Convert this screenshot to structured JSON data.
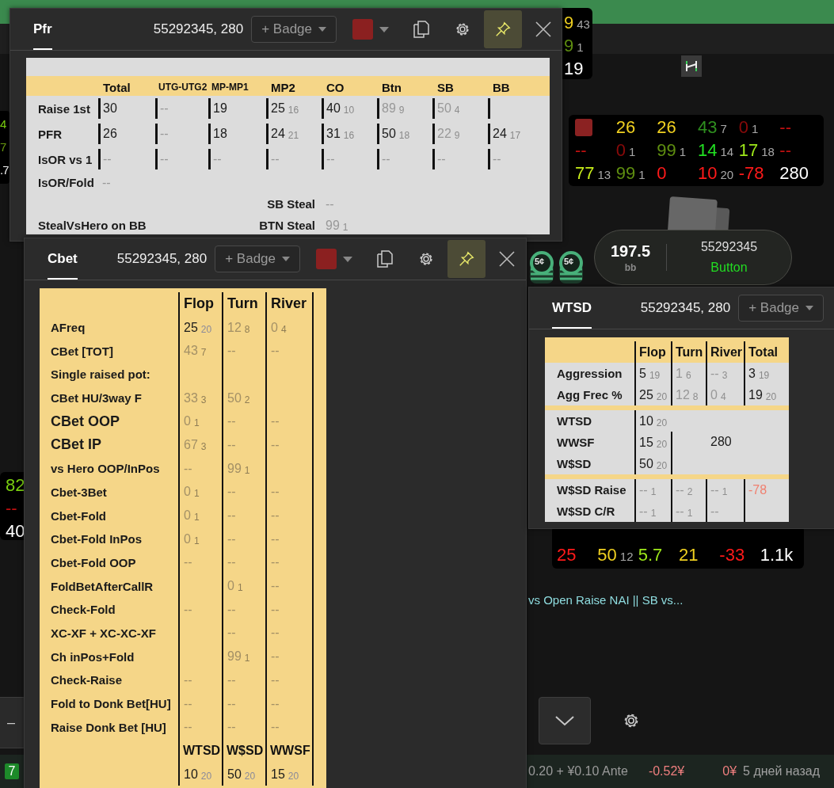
{
  "huds": [
    {
      "rows": [
        [
          {
            "kind": "stat",
            "value": "9",
            "count": "43",
            "color": "#f0d020"
          }
        ],
        [
          {
            "kind": "stat",
            "value": "9",
            "count": "1",
            "color": "#5f8f10"
          }
        ],
        [
          {
            "kind": "stat",
            "value": "19",
            "color": "#ffffff"
          }
        ]
      ]
    },
    {
      "rows": [
        [
          {
            "kind": "stat",
            "value": "4",
            "color": "#7ad010"
          }
        ],
        [
          {
            "kind": "stat",
            "value": "7",
            "color": "#6a9a10"
          }
        ],
        [
          {
            "kind": "stat",
            "value": ".7",
            "color": "#ffffff"
          }
        ]
      ]
    },
    {
      "rows": [
        [
          {
            "kind": "swatch",
            "color": "#8b2222"
          },
          {
            "kind": "stat",
            "value": "26",
            "color": "#f0d020"
          },
          {
            "kind": "stat",
            "value": "26",
            "color": "#f0d020"
          },
          {
            "kind": "stat",
            "value": "43",
            "count": "7",
            "color": "#2f8f1f"
          },
          {
            "kind": "stat",
            "value": "0",
            "count": "1",
            "color": "#8a0a0a"
          },
          {
            "kind": "stat",
            "value": "--",
            "color": "#c01010"
          }
        ],
        [
          {
            "kind": "stat",
            "value": "--",
            "color": "#c01010"
          },
          {
            "kind": "stat",
            "value": "0",
            "count": "1",
            "color": "#8a0a0a"
          },
          {
            "kind": "stat",
            "value": "99",
            "count": "1",
            "color": "#5f8f10"
          },
          {
            "kind": "stat",
            "value": "14",
            "count": "14",
            "color": "#22e022"
          },
          {
            "kind": "stat",
            "value": "17",
            "count": "18",
            "color": "#9ee81a"
          },
          {
            "kind": "stat",
            "value": "--",
            "color": "#c01010"
          }
        ],
        [
          {
            "kind": "stat",
            "value": "77",
            "count": "13",
            "color": "#c8ee1a"
          },
          {
            "kind": "stat",
            "value": "99",
            "count": "1",
            "color": "#5f8f10"
          },
          {
            "kind": "stat",
            "value": "0",
            "color": "#ff1a1a"
          },
          {
            "kind": "stat",
            "value": "10",
            "count": "20",
            "color": "#ff1a1a"
          },
          {
            "kind": "stat",
            "value": "-78",
            "color": "#ff1a1a"
          },
          {
            "kind": "stat",
            "value": "280",
            "color": "#ffffff"
          }
        ]
      ]
    },
    {
      "rows": [
        [
          {
            "kind": "stat",
            "value": "82",
            "color": "#7ad010"
          }
        ],
        [
          {
            "kind": "stat",
            "value": "--",
            "color": "#c01010"
          }
        ],
        [
          {
            "kind": "stat",
            "value": "40",
            "color": "#ffffff"
          }
        ]
      ]
    },
    {
      "rows": [
        [
          {
            "kind": "stat",
            "value": "25",
            "color": "#ff1a1a"
          },
          {
            "kind": "stat",
            "value": "50",
            "count": "12",
            "color": "#f0d020"
          },
          {
            "kind": "stat",
            "value": "5.7",
            "color": "#9ee81a"
          },
          {
            "kind": "stat",
            "value": "21",
            "color": "#f0d020"
          },
          {
            "kind": "stat",
            "value": "-33",
            "color": "#ff1a1a"
          },
          {
            "kind": "stat",
            "value": "1.1k",
            "color": "#ffffff"
          }
        ]
      ]
    }
  ],
  "player": {
    "stack": "197.5",
    "unit": "bb",
    "name": "55292345",
    "position": "Button"
  },
  "chips": [
    "5¢",
    "5¢"
  ],
  "hint": "vs Open Raise NAI || SB vs...",
  "controls": {
    "minus": "–"
  },
  "footer": {
    "badge": "7",
    "stakes": "0.20 + ¥0.10 Ante",
    "result": "-0.52¥",
    "amount": "0¥",
    "time": "5 дней назад"
  },
  "windows": [
    {
      "kind": "pfr",
      "tab": {
        "label": "Pfr",
        "selected": true
      },
      "title": "55292345, 280",
      "badge": "+ Badge",
      "color": "#8b2020",
      "pinned": true,
      "table": {
        "columns": [
          {
            "label": "Total",
            "compact": false
          },
          {
            "label": "UTG-UTG2",
            "compact": true
          },
          {
            "label": "MP-MP1",
            "compact": true
          },
          {
            "label": "MP2",
            "compact": false
          },
          {
            "label": "CO",
            "compact": false
          },
          {
            "label": "Btn",
            "compact": false
          },
          {
            "label": "SB",
            "compact": false
          },
          {
            "label": "BB",
            "compact": false
          }
        ],
        "rows": [
          {
            "label": "Raise 1st",
            "bars": true,
            "cells": [
              {
                "value": "30",
                "dim": false
              },
              {
                "value": "--",
                "dim": true
              },
              {
                "value": "19",
                "dim": false
              },
              {
                "value": "25",
                "count": "16",
                "dim": false
              },
              {
                "value": "40",
                "count": "10",
                "dim": false
              },
              {
                "value": "89",
                "count": "9",
                "dim": true
              },
              {
                "value": "50",
                "count": "4",
                "dim": true
              },
              null
            ]
          },
          {
            "label": "PFR",
            "bars": true,
            "cells": [
              {
                "value": "26",
                "dim": false
              },
              {
                "value": "--",
                "dim": true
              },
              {
                "value": "18",
                "dim": false
              },
              {
                "value": "24",
                "count": "21",
                "dim": false
              },
              {
                "value": "31",
                "count": "16",
                "dim": false
              },
              {
                "value": "50",
                "count": "18",
                "dim": false
              },
              {
                "value": "22",
                "count": "9",
                "dim": true
              },
              {
                "value": "24",
                "count": "17",
                "dim": false
              }
            ]
          },
          {
            "label": "IsOR vs 1",
            "bars": true,
            "cells": [
              {
                "value": "--",
                "dim": true
              },
              {
                "value": "--",
                "dim": true
              },
              {
                "value": "--",
                "dim": true
              },
              {
                "value": "--",
                "dim": true
              },
              {
                "value": "--",
                "dim": true
              },
              {
                "value": "--",
                "dim": true
              },
              {
                "value": "--",
                "dim": true
              },
              {
                "value": "--",
                "dim": true
              }
            ]
          },
          {
            "label": "IsOR/Fold",
            "bars": false,
            "cells": [
              {
                "value": "--",
                "dim": true
              }
            ]
          }
        ],
        "steals": [
          {
            "stat_label": "SB Steal",
            "cell": {
              "value": "--",
              "dim": true
            }
          },
          {
            "label": "StealVsHero on BB",
            "stat_label": "BTN Steal",
            "cell": {
              "value": "99",
              "count": "1",
              "dim": true
            }
          }
        ]
      }
    },
    {
      "kind": "cbet",
      "tab": {
        "label": "Cbet",
        "selected": true
      },
      "title": "55292345, 280",
      "badge": "+ Badge",
      "color": "#8b2020",
      "pinned": true,
      "table": {
        "columns": [
          "Flop",
          "Turn",
          "River"
        ],
        "rows": [
          {
            "label": "AFreq",
            "emphasis": false,
            "cells": [
              {
                "value": "25",
                "count": "20",
                "dim": false
              },
              {
                "value": "12",
                "count": "8",
                "dim": true
              },
              {
                "value": "0",
                "count": "4",
                "dim": true
              }
            ]
          },
          {
            "label": "CBet [TOT]",
            "emphasis": false,
            "cells": [
              {
                "value": "43",
                "count": "7",
                "dim": true
              },
              {
                "value": "--",
                "dim": true
              },
              {
                "value": "--",
                "dim": true
              }
            ]
          },
          {
            "label": "Single raised pot:",
            "emphasis": false,
            "cells": [
              null,
              null,
              null
            ]
          },
          {
            "label": "CBet HU/3way F",
            "emphasis": false,
            "cells": [
              {
                "value": "33",
                "count": "3",
                "dim": true
              },
              {
                "value": "50",
                "count": "2",
                "dim": true
              },
              null
            ]
          },
          {
            "label": "CBet OOP",
            "emphasis": true,
            "cells": [
              {
                "value": "0",
                "count": "1",
                "dim": true
              },
              {
                "value": "--",
                "dim": true
              },
              {
                "value": "--",
                "dim": true
              }
            ]
          },
          {
            "label": "CBet IP",
            "emphasis": true,
            "cells": [
              {
                "value": "67",
                "count": "3",
                "dim": true
              },
              {
                "value": "--",
                "dim": true
              },
              {
                "value": "--",
                "dim": true
              }
            ]
          },
          {
            "label": "vs Hero OOP/InPos",
            "emphasis": false,
            "cells": [
              {
                "value": "--",
                "dim": true
              },
              {
                "value": "99",
                "count": "1",
                "dim": true
              },
              null
            ]
          },
          {
            "label": "Cbet-3Bet",
            "emphasis": false,
            "cells": [
              {
                "value": "0",
                "count": "1",
                "dim": true
              },
              {
                "value": "--",
                "dim": true
              },
              {
                "value": "--",
                "dim": true
              }
            ]
          },
          {
            "label": "Cbet-Fold",
            "emphasis": false,
            "cells": [
              {
                "value": "0",
                "count": "1",
                "dim": true
              },
              {
                "value": "--",
                "dim": true
              },
              {
                "value": "--",
                "dim": true
              }
            ]
          },
          {
            "label": "Cbet-Fold InPos",
            "emphasis": false,
            "cells": [
              {
                "value": "0",
                "count": "1",
                "dim": true
              },
              {
                "value": "--",
                "dim": true
              },
              {
                "value": "--",
                "dim": true
              }
            ]
          },
          {
            "label": "Cbet-Fold OOP",
            "emphasis": false,
            "cells": [
              {
                "value": "--",
                "dim": true
              },
              {
                "value": "--",
                "dim": true
              },
              {
                "value": "--",
                "dim": true
              }
            ]
          },
          {
            "label": "FoldBetAfterCallR",
            "emphasis": false,
            "cells": [
              null,
              {
                "value": "0",
                "count": "1",
                "dim": true
              },
              {
                "value": "--",
                "dim": true
              }
            ]
          },
          {
            "label": "Check-Fold",
            "emphasis": false,
            "cells": [
              {
                "value": "--",
                "dim": true
              },
              {
                "value": "--",
                "dim": true
              },
              {
                "value": "--",
                "dim": true
              }
            ]
          },
          {
            "label": "XC-XF + XC-XC-XF",
            "emphasis": false,
            "cells": [
              null,
              {
                "value": "--",
                "dim": true
              },
              {
                "value": "--",
                "dim": true
              }
            ]
          },
          {
            "label": "Ch inPos+Fold",
            "emphasis": false,
            "cells": [
              null,
              {
                "value": "99",
                "count": "1",
                "dim": true
              },
              {
                "value": "--",
                "dim": true
              }
            ]
          },
          {
            "label": "Check-Raise",
            "emphasis": false,
            "cells": [
              {
                "value": "--",
                "dim": true
              },
              {
                "value": "--",
                "dim": true
              },
              {
                "value": "--",
                "dim": true
              }
            ]
          },
          {
            "label": "Fold to Donk Bet[HU]",
            "emphasis": false,
            "cells": [
              {
                "value": "--",
                "dim": true
              },
              {
                "value": "--",
                "dim": true
              },
              {
                "value": "--",
                "dim": true
              }
            ]
          },
          {
            "label": "Raise Donk Bet [HU]",
            "emphasis": false,
            "cells": [
              {
                "value": "--",
                "dim": true
              },
              {
                "value": "--",
                "dim": true
              },
              {
                "value": "--",
                "dim": true
              }
            ]
          }
        ],
        "footer": {
          "columns": [
            "WTSD",
            "W$SD",
            "WWSF"
          ],
          "cells": [
            {
              "value": "10",
              "count": "20",
              "dim": false
            },
            {
              "value": "50",
              "count": "20",
              "dim": false
            },
            {
              "value": "15",
              "count": "20",
              "dim": false
            }
          ]
        }
      }
    },
    {
      "kind": "wtsd",
      "tab": {
        "label": "WTSD",
        "selected": true
      },
      "title": "55292345, 280",
      "badge": "+ Badge",
      "table": {
        "columns": [
          "Flop",
          "Turn",
          "River",
          "Total"
        ],
        "actions": [
          {
            "label": "Aggression",
            "cells": [
              {
                "value": "5",
                "count": "19",
                "dim": false
              },
              {
                "value": "1",
                "count": "6",
                "dim": true
              },
              {
                "value": "--",
                "count": "3",
                "dim": true
              },
              {
                "value": "3",
                "count": "19",
                "dim": false
              }
            ]
          },
          {
            "label": "Agg Frec %",
            "cells": [
              {
                "value": "25",
                "count": "20",
                "dim": false
              },
              {
                "value": "12",
                "count": "8",
                "dim": true
              },
              {
                "value": "0",
                "count": "4",
                "dim": true
              },
              {
                "value": "19",
                "count": "20",
                "dim": false
              }
            ]
          }
        ],
        "showdown": {
          "rows": [
            {
              "label": "WTSD",
              "cell": {
                "value": "10",
                "count": "20",
                "dim": false
              }
            },
            {
              "label": "WWSF",
              "cell": {
                "value": "15",
                "count": "20",
                "dim": false
              }
            },
            {
              "label": "W$SD",
              "cell": {
                "value": "50",
                "count": "20",
                "dim": false
              }
            }
          ],
          "total": "280"
        },
        "results": [
          {
            "label": "W$SD Raise",
            "cells": [
              {
                "value": "--",
                "count": "1",
                "dim": true
              },
              {
                "value": "--",
                "count": "2",
                "dim": true
              },
              {
                "value": "--",
                "count": "1",
                "dim": true
              },
              {
                "value": "-78",
                "color": "#f08070"
              }
            ]
          },
          {
            "label": "W$SD C/R",
            "cells": [
              {
                "value": "--",
                "count": "1",
                "dim": true
              },
              {
                "value": "--",
                "count": "1",
                "dim": true
              },
              {
                "value": "--",
                "dim": true
              },
              null
            ]
          }
        ]
      }
    }
  ]
}
